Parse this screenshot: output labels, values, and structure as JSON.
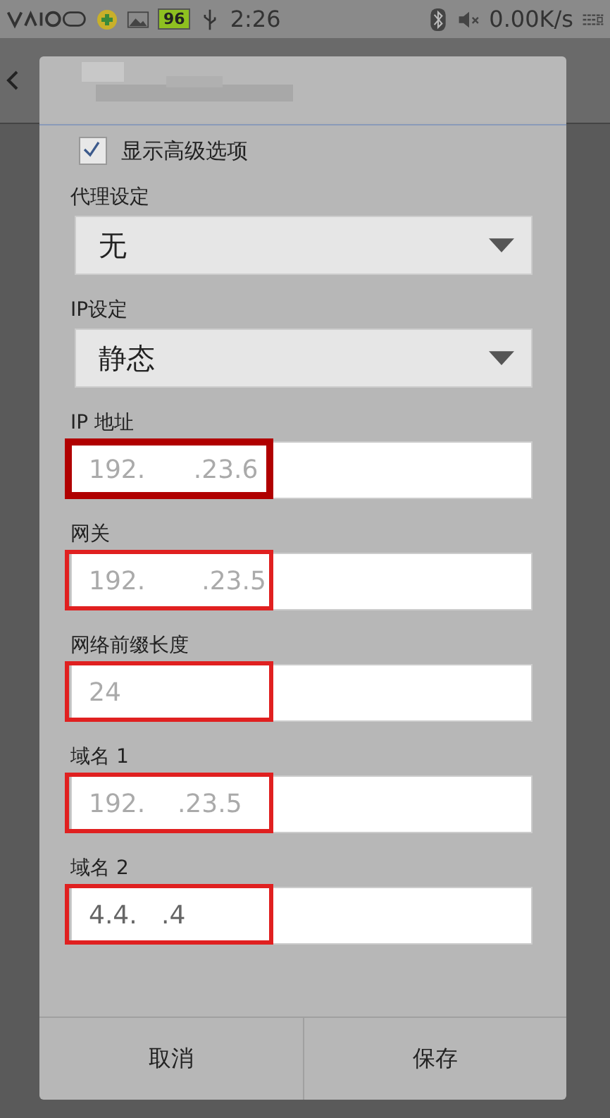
{
  "status_bar": {
    "battery": "96",
    "time": "2:26",
    "speed": "0.00K/s"
  },
  "dialog": {
    "show_advanced": {
      "label": "显示高级选项",
      "checked": true
    },
    "selects": [
      {
        "label": "代理设定",
        "value": "无"
      },
      {
        "label": "IP设定",
        "value": "静态"
      }
    ],
    "fields": [
      {
        "label": "IP 地址",
        "placeholder": "192.      .23.6",
        "highlighted": true,
        "color": "#b00000"
      },
      {
        "label": "网关",
        "placeholder": "192.       .23.5",
        "highlighted": true,
        "color": "#e02020"
      },
      {
        "label": "网络前缀长度",
        "placeholder": "24",
        "highlighted": true,
        "color": "#e02020"
      },
      {
        "label": "域名 1",
        "placeholder": "192.    .23.5",
        "highlighted": true,
        "color": "#e02020"
      },
      {
        "label": "域名 2",
        "value": "4.4.   .4",
        "highlighted": true,
        "color": "#e02020"
      }
    ],
    "buttons": [
      "取消",
      "保存"
    ]
  }
}
